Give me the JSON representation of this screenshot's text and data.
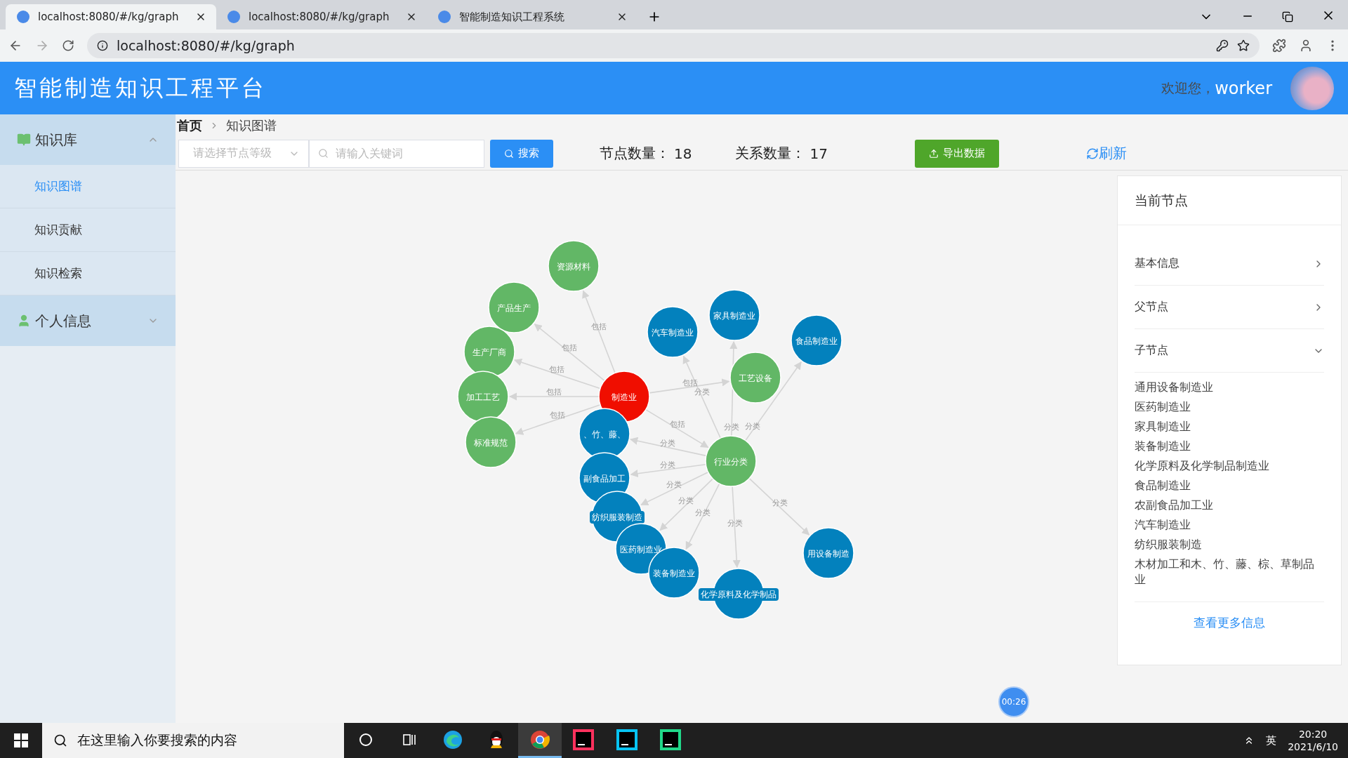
{
  "browser": {
    "tabs": [
      {
        "title": "localhost:8080/#/kg/graph",
        "selected": true
      },
      {
        "title": "localhost:8080/#/kg/graph",
        "selected": false
      },
      {
        "title": "智能制造知识工程系统",
        "selected": false
      }
    ],
    "address": "localhost:8080/#/kg/graph"
  },
  "header": {
    "title": "智能制造知识工程平台",
    "welcome": "欢迎您，",
    "username": "worker"
  },
  "sidebar": {
    "groups": [
      {
        "label": "知识库",
        "kind": "book",
        "expanded": true,
        "items": [
          {
            "label": "知识图谱",
            "selected": true
          },
          {
            "label": "知识贡献",
            "selected": false
          },
          {
            "label": "知识检索",
            "selected": false
          }
        ]
      },
      {
        "label": "个人信息",
        "kind": "person",
        "expanded": false
      }
    ]
  },
  "breadcrumb": [
    "首页",
    "知识图谱"
  ],
  "toolbar": {
    "level_select": {
      "placeholder": "请选择节点等级"
    },
    "search": {
      "placeholder": "请输入关键词"
    },
    "search_button": "搜索",
    "node_count_label": "节点数量：",
    "node_count": "18",
    "relation_count_label": "关系数量：",
    "relation_count": "17",
    "export_button": "导出数据",
    "refresh_button": "刷新"
  },
  "graph": {
    "nodes": [
      {
        "label": "制造业",
        "color": "#f00e00"
      },
      {
        "label": "资源材料",
        "color": "#62b766"
      },
      {
        "label": "产品生产",
        "color": "#62b766"
      },
      {
        "label": "生产厂商",
        "color": "#62b766"
      },
      {
        "label": "加工工艺",
        "color": "#62b766"
      },
      {
        "label": "标准规范",
        "color": "#62b766"
      },
      {
        "label": "工艺设备",
        "color": "#62b766"
      },
      {
        "label": "行业分类",
        "color": "#62b766"
      },
      {
        "label": "汽车制造业",
        "color": "#0381bd"
      },
      {
        "label": "家具制造业",
        "color": "#0381bd"
      },
      {
        "label": "食品制造业",
        "color": "#0381bd"
      },
      {
        "label": "、竹、藤、",
        "color": "#0381bd"
      },
      {
        "label": "副食品加工",
        "color": "#0381bd"
      },
      {
        "label": "纺织服装制造",
        "color": "#0381bd"
      },
      {
        "label": "医药制造业",
        "color": "#0381bd"
      },
      {
        "label": "装备制造业",
        "color": "#0381bd"
      },
      {
        "label": "化学原料及化学制品",
        "color": "#0381bd"
      },
      {
        "label": "用设备制造",
        "color": "#0381bd"
      }
    ],
    "edges": [
      {
        "label": "包括"
      },
      {
        "label": "包括"
      },
      {
        "label": "包括"
      },
      {
        "label": "包括"
      },
      {
        "label": "包括"
      },
      {
        "label": "包括"
      },
      {
        "label": "包括"
      },
      {
        "label": "分类"
      },
      {
        "label": "分类"
      },
      {
        "label": "分类"
      },
      {
        "label": "分类"
      },
      {
        "label": "分类"
      },
      {
        "label": "分类"
      },
      {
        "label": "分类"
      },
      {
        "label": "分类"
      },
      {
        "label": "分类"
      },
      {
        "label": "分类"
      }
    ]
  },
  "panel": {
    "title": "当前节点",
    "sections": [
      {
        "label": "基本信息",
        "expanded": false
      },
      {
        "label": "父节点",
        "expanded": false
      },
      {
        "label": "子节点",
        "expanded": true,
        "items": [
          "通用设备制造业",
          "医药制造业",
          "家具制造业",
          "装备制造业",
          "化学原料及化学制品制造业",
          "食品制造业",
          "农副食品加工业",
          "汽车制造业",
          "纺织服装制造",
          "木材加工和木、竹、藤、棕、草制品业"
        ]
      }
    ],
    "more_link": "查看更多信息"
  },
  "timer": "00:26",
  "taskbar": {
    "search_placeholder": "在这里输入你要搜索的内容",
    "apps": [
      {
        "kind": "cortana",
        "selected": false
      },
      {
        "kind": "taskview",
        "selected": false
      },
      {
        "kind": "edge",
        "selected": false
      },
      {
        "kind": "qq",
        "selected": false
      },
      {
        "kind": "chrome",
        "selected": true
      },
      {
        "kind": "idea",
        "selected": false
      },
      {
        "kind": "webstorm",
        "selected": false
      },
      {
        "kind": "pycharm",
        "selected": false
      }
    ],
    "ime": "英",
    "time": "20:20",
    "date": "2021/6/10"
  }
}
